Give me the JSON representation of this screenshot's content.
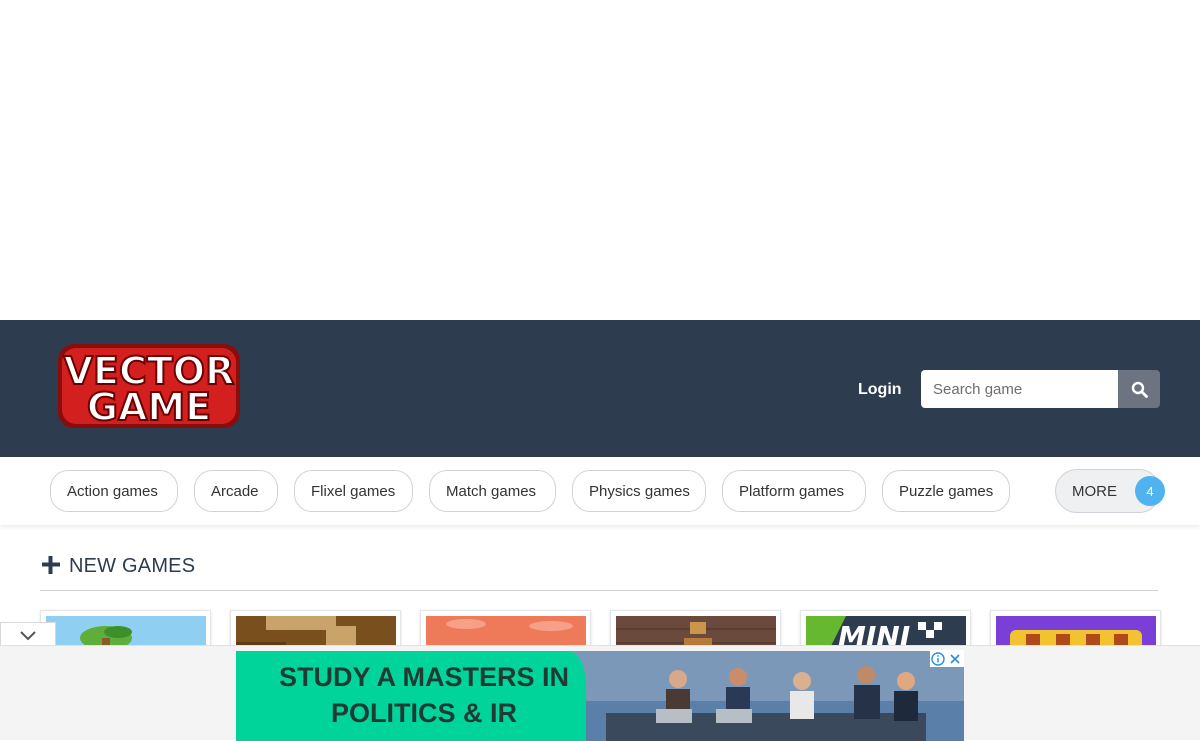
{
  "header": {
    "logo_line1": "VECTOR",
    "logo_line2": "GAME",
    "login_label": "Login",
    "search_placeholder": "Search game",
    "search_icon": "search-icon",
    "background_color": "#2e3c4f"
  },
  "categories": {
    "items": [
      {
        "label": "Action games"
      },
      {
        "label": "Arcade"
      },
      {
        "label": "Flixel games"
      },
      {
        "label": "Match games"
      },
      {
        "label": "Physics games"
      },
      {
        "label": "Platform games"
      },
      {
        "label": "Puzzle games"
      }
    ],
    "more_label": "MORE",
    "more_count": "4",
    "badge_color": "#4fb3f0"
  },
  "new_games": {
    "title": "NEW GAMES",
    "icon": "plus-icon"
  },
  "game_cards": [
    {
      "thumb": "jungle-game-thumbnail"
    },
    {
      "thumb": "dirt-maze-game-thumbnail"
    },
    {
      "thumb": "orange-sky-game-thumbnail"
    },
    {
      "thumb": "brick-wall-game-thumbnail"
    },
    {
      "thumb": "mini-racing-game-thumbnail"
    },
    {
      "thumb": "ninja-game-thumbnail"
    }
  ],
  "sticky_ad": {
    "banner_text": "STUDY A MASTERS IN\nPOLITICS & IR",
    "banner_color": "#00d49a",
    "collapse_icon": "chevron-down-icon",
    "info_icon": "info-icon",
    "close_icon": "close-icon"
  }
}
